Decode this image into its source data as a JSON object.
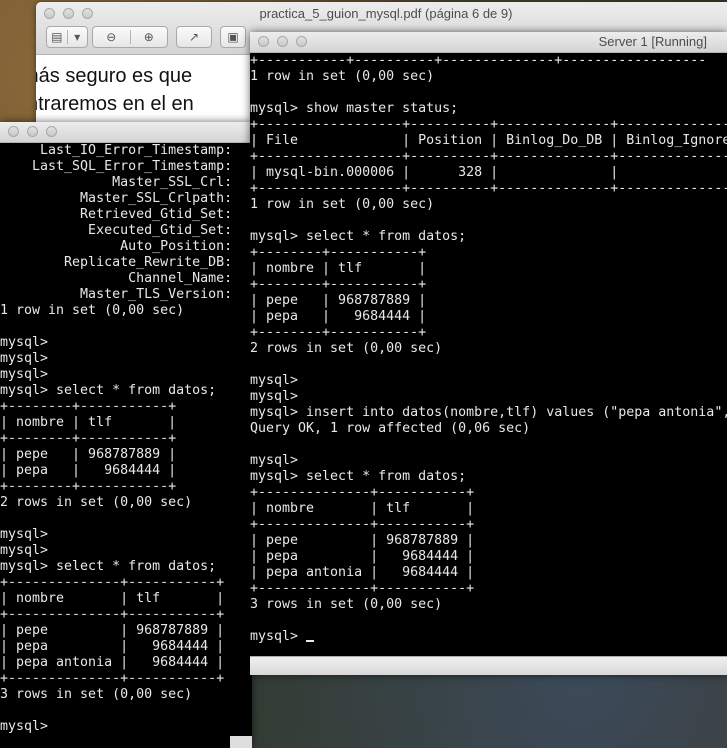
{
  "pdf_viewer": {
    "title": "practica_5_guion_mysql.pdf (página 6 de 9)",
    "toolbar_icons": [
      "sidebar-icon",
      "zoom-out-icon",
      "zoom-in-icon",
      "share-icon",
      "window-icon"
    ],
    "visible_text": [
      "más seguro es que",
      "ntraremos en el en"
    ]
  },
  "server_window": {
    "title": "Server 1 [Running]",
    "lines": [
      "+-----------+----------+--------------+------------------",
      "1 row in set (0,00 sec)",
      "",
      "mysql> show master status;",
      "+------------------+----------+--------------+------------------",
      "| File             | Position | Binlog_Do_DB | Binlog_Ignore",
      "+------------------+----------+--------------+------------------",
      "| mysql-bin.000006 |      328 |              |",
      "+------------------+----------+--------------+------------------",
      "1 row in set (0,00 sec)",
      "",
      "mysql> select * from datos;",
      "+--------+-----------+",
      "| nombre | tlf       |",
      "+--------+-----------+",
      "| pepe   | 968787889 |",
      "| pepa   |   9684444 |",
      "+--------+-----------+",
      "2 rows in set (0,00 sec)",
      "",
      "mysql>",
      "mysql>",
      "mysql> insert into datos(nombre,tlf) values (\"pepa antonia\",",
      "Query OK, 1 row affected (0,06 sec)",
      "",
      "mysql>",
      "mysql> select * from datos;",
      "+--------------+-----------+",
      "| nombre       | tlf       |",
      "+--------------+-----------+",
      "| pepe         | 968787889 |",
      "| pepa         |   9684444 |",
      "| pepa antonia |   9684444 |",
      "+--------------+-----------+",
      "3 rows in set (0,00 sec)",
      "",
      "mysql> "
    ]
  },
  "left_terminal": {
    "lines": [
      "     Last_IO_Error_Timestamp:",
      "    Last_SQL_Error_Timestamp:",
      "              Master_SSL_Crl:",
      "          Master_SSL_Crlpath:",
      "          Retrieved_Gtid_Set:",
      "           Executed_Gtid_Set:",
      "               Auto_Position:",
      "        Replicate_Rewrite_DB:",
      "                Channel_Name:",
      "          Master_TLS_Version:",
      "1 row in set (0,00 sec)",
      "",
      "mysql>",
      "mysql>",
      "mysql>",
      "mysql> select * from datos;",
      "+--------+-----------+",
      "| nombre | tlf       |",
      "+--------+-----------+",
      "| pepe   | 968787889 |",
      "| pepa   |   9684444 |",
      "+--------+-----------+",
      "2 rows in set (0,00 sec)",
      "",
      "mysql>",
      "mysql>",
      "mysql> select * from datos;",
      "+--------------+-----------+",
      "| nombre       | tlf       |",
      "+--------------+-----------+",
      "| pepe         | 968787889 |",
      "| pepa         |   9684444 |",
      "| pepa antonia |   9684444 |",
      "+--------------+-----------+",
      "3 rows in set (0,00 sec)",
      "",
      "mysql>"
    ]
  }
}
